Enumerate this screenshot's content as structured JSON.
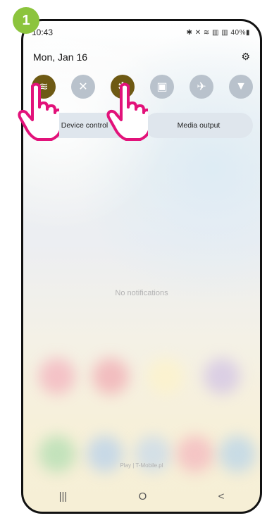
{
  "step_badge": "1",
  "status_bar": {
    "time": "10:43",
    "icons_text": "✱ ✕ ≋ ▥ ▥ 40%▮"
  },
  "header": {
    "date": "Mon, Jan 16",
    "settings_icon": "gear-icon"
  },
  "quick_tiles": [
    {
      "name": "wifi",
      "icon": "wifi-icon",
      "glyph": "≋",
      "active": true
    },
    {
      "name": "sound",
      "icon": "mute-icon",
      "glyph": "✕",
      "active": false
    },
    {
      "name": "bluetooth",
      "icon": "bluetooth-icon",
      "glyph": "✱",
      "active": true
    },
    {
      "name": "rotation",
      "icon": "rotation-icon",
      "glyph": "▣",
      "active": false
    },
    {
      "name": "airplane",
      "icon": "airplane-icon",
      "glyph": "✈",
      "active": false
    },
    {
      "name": "flashlight",
      "icon": "flashlight-icon",
      "glyph": "▼",
      "active": false
    }
  ],
  "buttons": {
    "device_control": "Device control",
    "media_output": "Media output"
  },
  "notifications": {
    "empty_text": "No notifications"
  },
  "footer": {
    "carrier": "Play | T-Mobile.pl"
  },
  "nav_bar": {
    "recents": "|||",
    "home": "O",
    "back": "<"
  },
  "colors": {
    "tile_active": "#6e5a14",
    "tile_inactive": "#b9c2cc",
    "badge": "#8cc43d",
    "hand_outline": "#e2127a"
  }
}
